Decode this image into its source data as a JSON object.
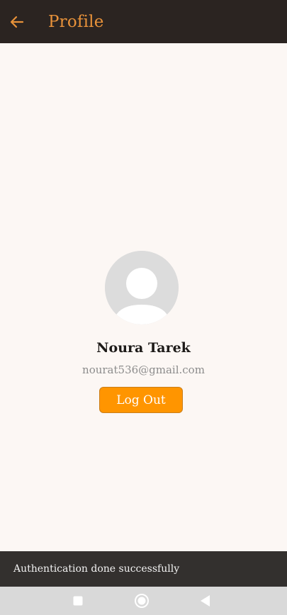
{
  "appbar": {
    "title": "Profile",
    "back_icon": "arrow-left-icon",
    "background": "#2b2421",
    "accent": "#e8923a"
  },
  "profile": {
    "avatar_icon": "person-avatar-icon",
    "name": "Noura Tarek",
    "email": "nourat536@gmail.com",
    "logout_label": "Log Out",
    "button_color": "#ff9500"
  },
  "snackbar": {
    "message": "Authentication done successfully"
  },
  "system_nav": {
    "recents_icon": "square-icon",
    "home_icon": "circle-icon",
    "back_icon": "triangle-back-icon"
  }
}
